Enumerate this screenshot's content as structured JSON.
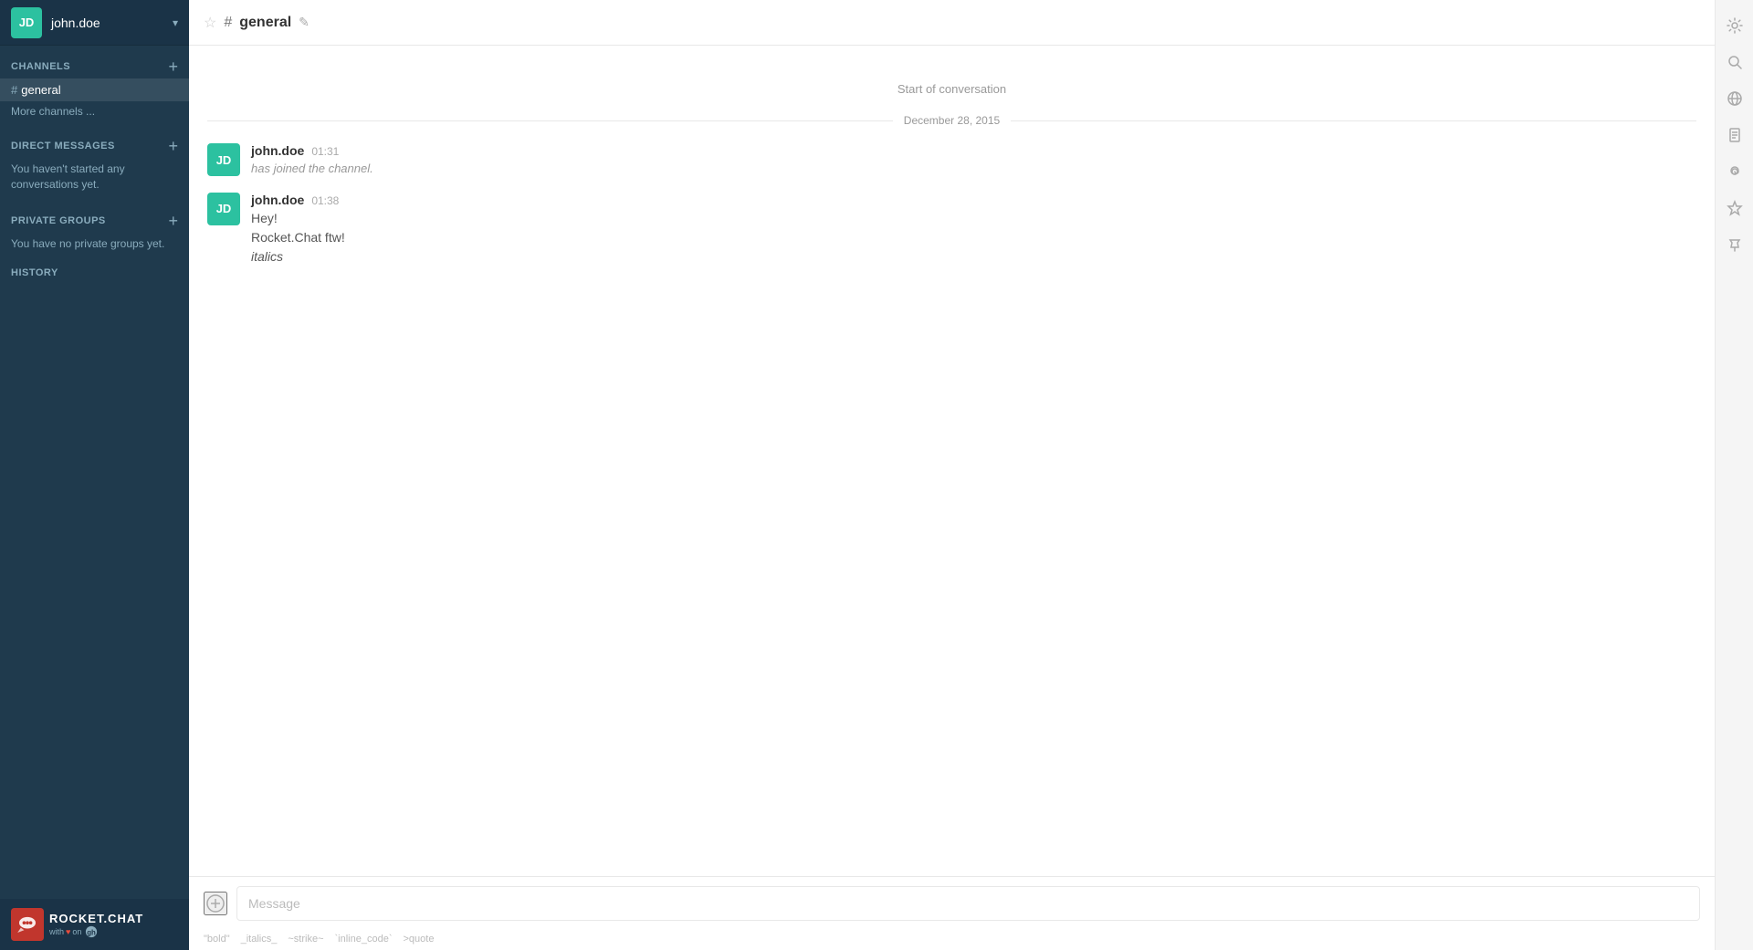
{
  "sidebar": {
    "user": {
      "name": "john.doe",
      "initials": "JD",
      "avatar_bg": "#2cc1a0"
    },
    "channels": {
      "label": "CHANNELS",
      "add_label": "+",
      "items": [
        {
          "name": "general",
          "active": true
        }
      ],
      "more_label": "More channels ..."
    },
    "direct_messages": {
      "label": "DIRECT MESSAGES",
      "add_label": "+",
      "empty_text": "You haven't started any conversations yet."
    },
    "private_groups": {
      "label": "PRIVATE GROUPS",
      "add_label": "+",
      "empty_text": "You have no private groups yet."
    },
    "history": {
      "label": "HISTORY"
    },
    "footer": {
      "logo_name": "ROCKET.CHAT",
      "logo_sub_with": "with",
      "logo_sub_on": "on"
    }
  },
  "header": {
    "channel_name": "general",
    "star_icon": "☆",
    "hash_icon": "#",
    "edit_icon": "✎"
  },
  "chat": {
    "start_label": "Start of conversation",
    "date_label": "December 28, 2015",
    "messages": [
      {
        "author": "john.doe",
        "time": "01:31",
        "initials": "JD",
        "avatar_bg": "#2cc1a0",
        "text": "has joined the channel.",
        "italic": true
      },
      {
        "author": "john.doe",
        "time": "01:38",
        "initials": "JD",
        "avatar_bg": "#2cc1a0",
        "lines": [
          "Hey!",
          "Rocket.Chat ftw!",
          "italics"
        ],
        "italic_last": true
      }
    ]
  },
  "input": {
    "placeholder": "Message",
    "attach_icon": "⊕"
  },
  "format_hints": [
    {
      "label": "\"bold\""
    },
    {
      "label": "_italics_"
    },
    {
      "label": "~strike~"
    },
    {
      "label": "`inline_code`"
    },
    {
      "label": ">quote"
    }
  ],
  "right_sidebar": {
    "icons": [
      {
        "name": "settings-icon",
        "symbol": "⚙"
      },
      {
        "name": "search-icon",
        "symbol": "🔍"
      },
      {
        "name": "globe-icon",
        "symbol": "🌐"
      },
      {
        "name": "file-icon",
        "symbol": "📄"
      },
      {
        "name": "at-icon",
        "symbol": "@"
      },
      {
        "name": "star-icon",
        "symbol": "★"
      },
      {
        "name": "pin-icon",
        "symbol": "📌"
      }
    ]
  }
}
